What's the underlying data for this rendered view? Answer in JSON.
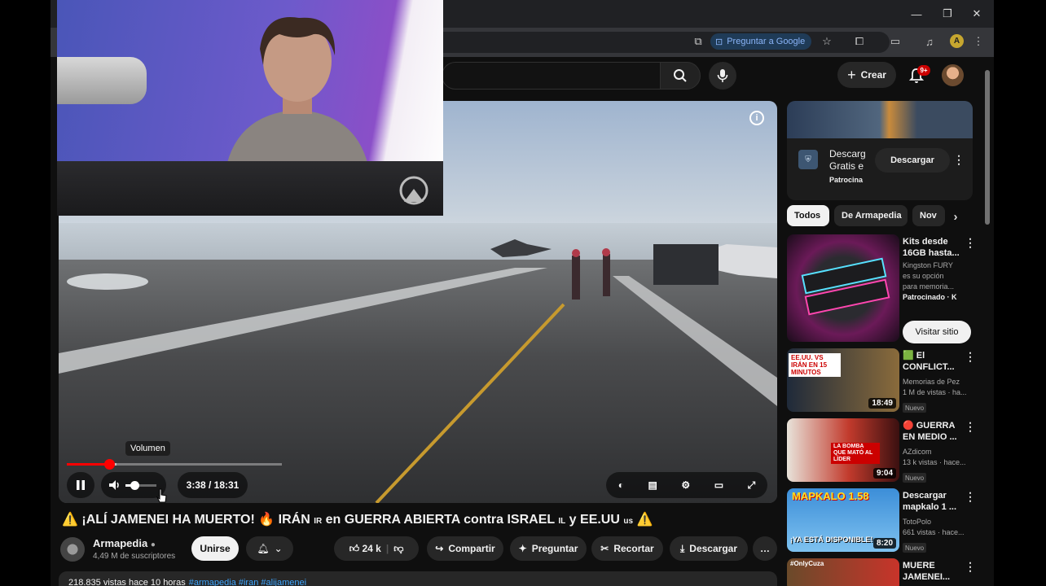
{
  "browser": {
    "ask_google_label": "Preguntar a Google",
    "profile_initial": "A"
  },
  "header": {
    "create_label": "Crear",
    "notification_badge": "9+"
  },
  "player": {
    "tooltip": "Volumen",
    "time": "3:38 / 18:31",
    "progress_fraction": 0.196,
    "buffered_fraction": 0.23,
    "volume_fraction": 0.3,
    "accent_color": "#ff0000"
  },
  "video": {
    "title_warn_left": "⚠️",
    "title_main": "¡ALÍ JAMENEI HA MUERTO! 🔥 IRÁN",
    "title_ir": "IR",
    "title_mid": "en GUERRA ABIERTA contra ISRAEL",
    "title_il": "IL",
    "title_and": "y EE.UU",
    "title_us": "us",
    "title_warn_right": "⚠️",
    "channel_name": "Armapedia",
    "subscribers": "4,49 M de suscriptores",
    "join_label": "Unirse",
    "likes": "24 k",
    "share_label": "Compartir",
    "ask_label": "Preguntar",
    "clip_label": "Recortar",
    "download_label": "Descargar",
    "description_stats": "218.835 vistas  hace 10 horas",
    "description_tags": "#armapedia #iran #alijamenei"
  },
  "sidebar": {
    "ad": {
      "line1": "Descarg",
      "line2": "Gratis e",
      "sponsor": "Patrocina",
      "download_label": "Descargar"
    },
    "chips": [
      "Todos",
      "De Armapedia",
      "Nov"
    ],
    "items": [
      {
        "title_1": "Kits desde",
        "title_2": "16GB hasta...",
        "meta_1": "Kingston FURY",
        "meta_2": "es su opción",
        "meta_3": "para memoria...",
        "meta_4": "Patrocinado · K",
        "visit_label": "Visitar sitio"
      },
      {
        "title_1": "🟩 El",
        "title_2": "CONFLICT...",
        "meta_1": "Memorias de Pez",
        "meta_2": "1 M de vistas · ha...",
        "badge": "Nuevo",
        "duration": "18:49",
        "thumb_caption": "EE.UU. VS IRÁN EN 15 MINUTOS"
      },
      {
        "title_1": "🔴 GUERRA",
        "title_2": "EN MEDIO ...",
        "meta_1": "AZdicom",
        "meta_2": "13 k vistas · hace...",
        "badge": "Nuevo",
        "duration": "9:04",
        "thumb_caption": "LA BOMBA QUE MATÓ AL LÍDER"
      },
      {
        "title_1": "Descargar",
        "title_2": "mapkalo 1 ...",
        "meta_1": "TotoPolo",
        "meta_2": "661 vistas · hace...",
        "badge": "Nuevo",
        "duration": "8:20",
        "thumb_caption_top": "MAPKALO 1.58",
        "thumb_caption_bottom": "¡YA ESTÁ DISPONIBLE!"
      },
      {
        "title_1": "MUERE",
        "title_2": "JAMENEI...",
        "thumb_caption": "#OnlyCuza"
      }
    ]
  }
}
